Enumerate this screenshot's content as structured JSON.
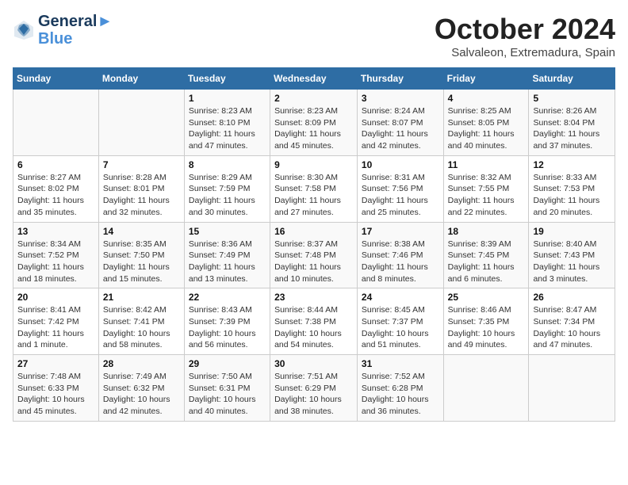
{
  "header": {
    "logo_line1": "General",
    "logo_line2": "Blue",
    "month_title": "October 2024",
    "subtitle": "Salvaleon, Extremadura, Spain"
  },
  "weekdays": [
    "Sunday",
    "Monday",
    "Tuesday",
    "Wednesday",
    "Thursday",
    "Friday",
    "Saturday"
  ],
  "weeks": [
    [
      {
        "day": "",
        "info": ""
      },
      {
        "day": "",
        "info": ""
      },
      {
        "day": "1",
        "info": "Sunrise: 8:23 AM\nSunset: 8:10 PM\nDaylight: 11 hours and 47 minutes."
      },
      {
        "day": "2",
        "info": "Sunrise: 8:23 AM\nSunset: 8:09 PM\nDaylight: 11 hours and 45 minutes."
      },
      {
        "day": "3",
        "info": "Sunrise: 8:24 AM\nSunset: 8:07 PM\nDaylight: 11 hours and 42 minutes."
      },
      {
        "day": "4",
        "info": "Sunrise: 8:25 AM\nSunset: 8:05 PM\nDaylight: 11 hours and 40 minutes."
      },
      {
        "day": "5",
        "info": "Sunrise: 8:26 AM\nSunset: 8:04 PM\nDaylight: 11 hours and 37 minutes."
      }
    ],
    [
      {
        "day": "6",
        "info": "Sunrise: 8:27 AM\nSunset: 8:02 PM\nDaylight: 11 hours and 35 minutes."
      },
      {
        "day": "7",
        "info": "Sunrise: 8:28 AM\nSunset: 8:01 PM\nDaylight: 11 hours and 32 minutes."
      },
      {
        "day": "8",
        "info": "Sunrise: 8:29 AM\nSunset: 7:59 PM\nDaylight: 11 hours and 30 minutes."
      },
      {
        "day": "9",
        "info": "Sunrise: 8:30 AM\nSunset: 7:58 PM\nDaylight: 11 hours and 27 minutes."
      },
      {
        "day": "10",
        "info": "Sunrise: 8:31 AM\nSunset: 7:56 PM\nDaylight: 11 hours and 25 minutes."
      },
      {
        "day": "11",
        "info": "Sunrise: 8:32 AM\nSunset: 7:55 PM\nDaylight: 11 hours and 22 minutes."
      },
      {
        "day": "12",
        "info": "Sunrise: 8:33 AM\nSunset: 7:53 PM\nDaylight: 11 hours and 20 minutes."
      }
    ],
    [
      {
        "day": "13",
        "info": "Sunrise: 8:34 AM\nSunset: 7:52 PM\nDaylight: 11 hours and 18 minutes."
      },
      {
        "day": "14",
        "info": "Sunrise: 8:35 AM\nSunset: 7:50 PM\nDaylight: 11 hours and 15 minutes."
      },
      {
        "day": "15",
        "info": "Sunrise: 8:36 AM\nSunset: 7:49 PM\nDaylight: 11 hours and 13 minutes."
      },
      {
        "day": "16",
        "info": "Sunrise: 8:37 AM\nSunset: 7:48 PM\nDaylight: 11 hours and 10 minutes."
      },
      {
        "day": "17",
        "info": "Sunrise: 8:38 AM\nSunset: 7:46 PM\nDaylight: 11 hours and 8 minutes."
      },
      {
        "day": "18",
        "info": "Sunrise: 8:39 AM\nSunset: 7:45 PM\nDaylight: 11 hours and 6 minutes."
      },
      {
        "day": "19",
        "info": "Sunrise: 8:40 AM\nSunset: 7:43 PM\nDaylight: 11 hours and 3 minutes."
      }
    ],
    [
      {
        "day": "20",
        "info": "Sunrise: 8:41 AM\nSunset: 7:42 PM\nDaylight: 11 hours and 1 minute."
      },
      {
        "day": "21",
        "info": "Sunrise: 8:42 AM\nSunset: 7:41 PM\nDaylight: 10 hours and 58 minutes."
      },
      {
        "day": "22",
        "info": "Sunrise: 8:43 AM\nSunset: 7:39 PM\nDaylight: 10 hours and 56 minutes."
      },
      {
        "day": "23",
        "info": "Sunrise: 8:44 AM\nSunset: 7:38 PM\nDaylight: 10 hours and 54 minutes."
      },
      {
        "day": "24",
        "info": "Sunrise: 8:45 AM\nSunset: 7:37 PM\nDaylight: 10 hours and 51 minutes."
      },
      {
        "day": "25",
        "info": "Sunrise: 8:46 AM\nSunset: 7:35 PM\nDaylight: 10 hours and 49 minutes."
      },
      {
        "day": "26",
        "info": "Sunrise: 8:47 AM\nSunset: 7:34 PM\nDaylight: 10 hours and 47 minutes."
      }
    ],
    [
      {
        "day": "27",
        "info": "Sunrise: 7:48 AM\nSunset: 6:33 PM\nDaylight: 10 hours and 45 minutes."
      },
      {
        "day": "28",
        "info": "Sunrise: 7:49 AM\nSunset: 6:32 PM\nDaylight: 10 hours and 42 minutes."
      },
      {
        "day": "29",
        "info": "Sunrise: 7:50 AM\nSunset: 6:31 PM\nDaylight: 10 hours and 40 minutes."
      },
      {
        "day": "30",
        "info": "Sunrise: 7:51 AM\nSunset: 6:29 PM\nDaylight: 10 hours and 38 minutes."
      },
      {
        "day": "31",
        "info": "Sunrise: 7:52 AM\nSunset: 6:28 PM\nDaylight: 10 hours and 36 minutes."
      },
      {
        "day": "",
        "info": ""
      },
      {
        "day": "",
        "info": ""
      }
    ]
  ]
}
